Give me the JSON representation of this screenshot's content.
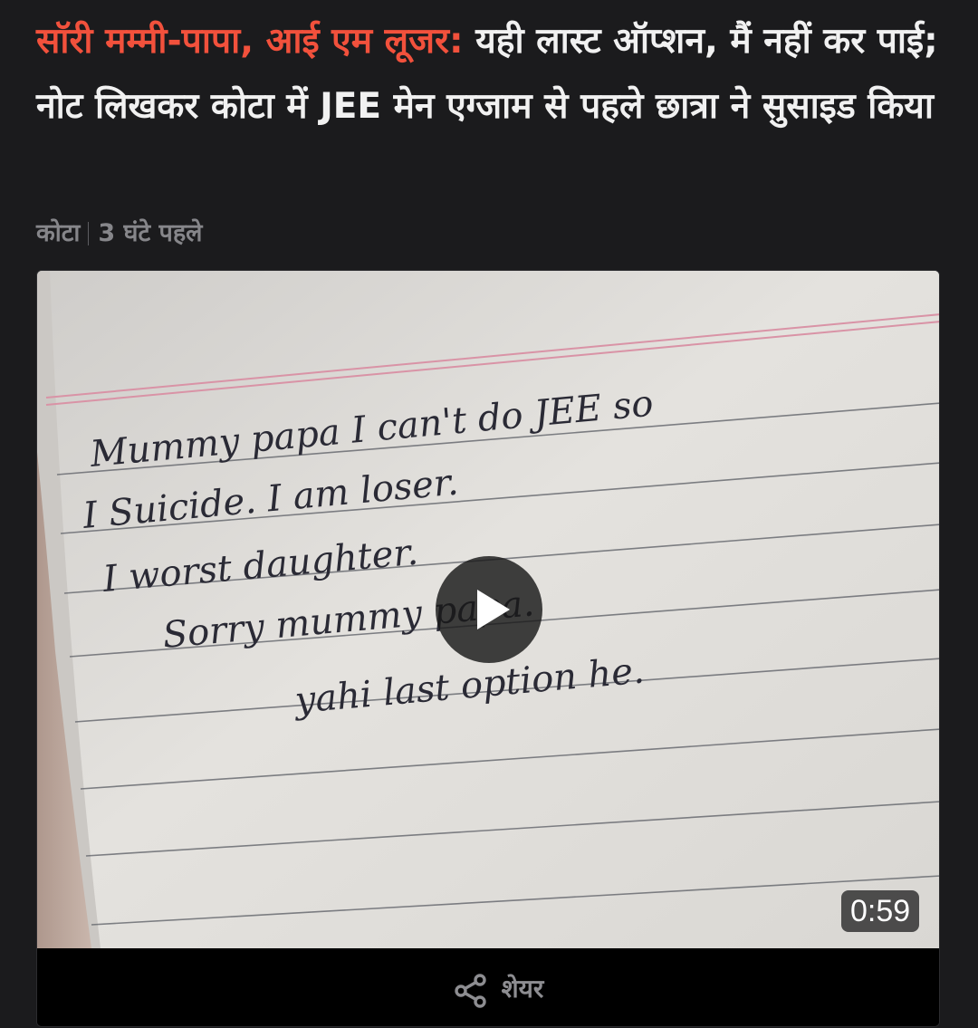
{
  "article": {
    "headline_highlight": "सॉरी मम्मी-पापा, आई एम लूजर:",
    "headline_rest": " यही लास्ट ऑप्शन, मैं नहीं कर पाई; नोट लिखकर कोटा में JEE मेन एग्जाम से पहले छात्रा ने सुसाइड किया",
    "location": "कोटा",
    "time_ago": "3 घंटे पहले"
  },
  "video": {
    "note_lines": [
      "Mummy papa I can't do JEE so",
      "I Suicide. I am loser.",
      "I worst daughter.",
      "Sorry mummy papa.",
      "yahi last option he."
    ],
    "duration": "0:59",
    "play_icon": "play-icon"
  },
  "share": {
    "label": "शेयर",
    "icon": "share-icon"
  },
  "colors": {
    "background": "#1b1b1d",
    "headline_text": "#f1f1f1",
    "headline_accent": "#f2513c",
    "meta_text": "#86868a",
    "share_text": "#8d8d91"
  }
}
